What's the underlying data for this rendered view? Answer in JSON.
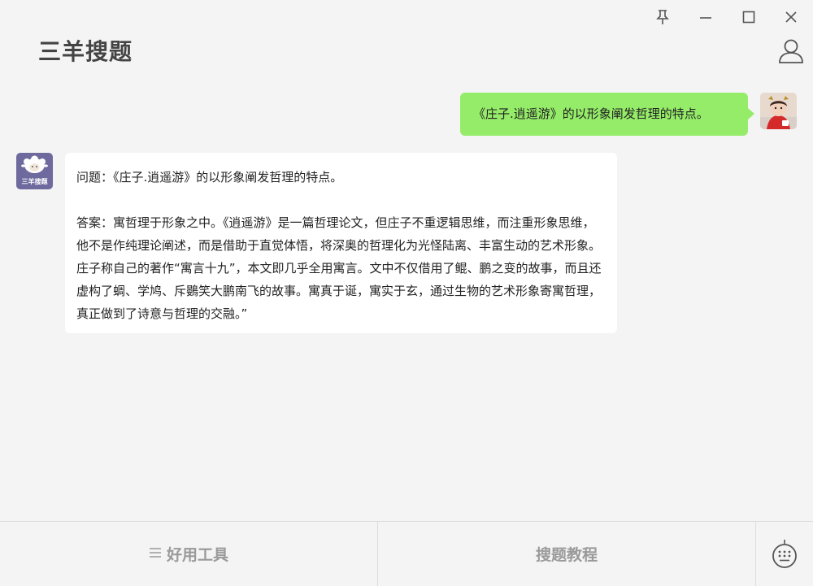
{
  "app": {
    "title": "三羊搜题"
  },
  "window_controls": [
    "pin-icon",
    "minimize-icon",
    "maximize-icon",
    "close-icon"
  ],
  "chat": {
    "user_message": "《庄子.逍遥游》的以形象阐发哲理的特点。",
    "bot_avatar_text": "三羊搜题",
    "bot_question": "问题：《庄子.逍遥游》的以形象阐发哲理的特点。",
    "bot_answer": "答案：寓哲理于形象之中。《逍遥游》是一篇哲理论文，但庄子不重逻辑思维，而注重形象思维，他不是作纯理论阐述，而是借助于直觉体悟，将深奥的哲理化为光怪陆离、丰富生动的艺术形象。庄子称自己的著作“寓言十九”，本文即几乎全用寓言。文中不仅借用了鲲、鹏之变的故事，而且还虚构了蜩、学鸠、斥鷃笑大鹏南飞的故事。寓真于诞，寓实于玄，通过生物的艺术形象寄寓哲理，真正做到了诗意与哲理的交融。”"
  },
  "bottom": {
    "tools_label": "好用工具",
    "tutorial_label": "搜题教程"
  },
  "colors": {
    "user_bubble": "#95ec69",
    "bot_bubble": "#ffffff",
    "background": "#f4f4f4",
    "bot_avatar_bg": "#6e6a9e"
  }
}
